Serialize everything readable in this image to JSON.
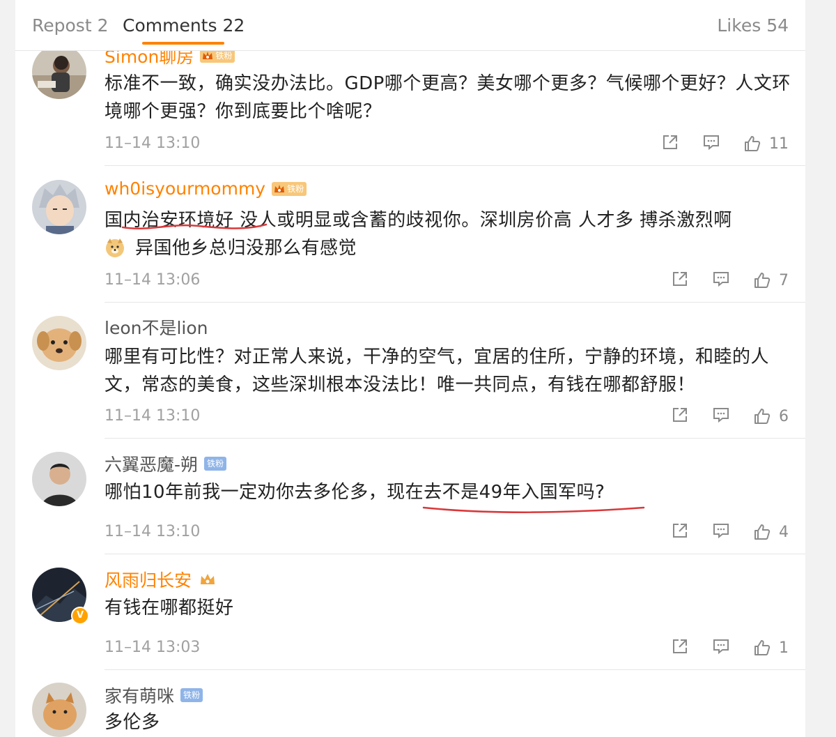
{
  "tabs": {
    "repost": "Repost 2",
    "comments": "Comments 22",
    "likes": "Likes 54",
    "accent_color": "#ff8200"
  },
  "fan_badge_label": "铁粉",
  "comments": [
    {
      "username": "Simon聊房",
      "text": "标准不一致，确实没办法比。GDP哪个更高？美女哪个更多？气候哪个更好？人文环境哪个更强？你到底要比个啥呢？",
      "time": "11–14 13:10",
      "likes": "11"
    },
    {
      "username": "wh0isyourmommy",
      "text": "国内治安环境好 没人或明显或含蓄的歧视你。深圳房价高 人才多 搏杀激烈啊",
      "text_line2": "异国他乡总归没那么有感觉",
      "time": "11–14 13:06",
      "likes": "7"
    },
    {
      "username": "leon不是lion",
      "text": "哪里有可比性？对正常人来说，干净的空气，宜居的住所，宁静的环境，和睦的人文，常态的美食，这些深圳根本没法比！唯一共同点，有钱在哪都舒服！",
      "time": "11–14 13:10",
      "likes": "6"
    },
    {
      "username": "六翼恶魔-朔",
      "text": "哪怕10年前我一定劝你去多伦多，现在去不是49年入国军吗?",
      "time": "11–14 13:10",
      "likes": "4"
    },
    {
      "username": "风雨归长安",
      "text": "有钱在哪都挺好",
      "time": "11–14 13:03",
      "likes": "1"
    },
    {
      "username": "家有萌咪",
      "text": "多伦多"
    }
  ]
}
